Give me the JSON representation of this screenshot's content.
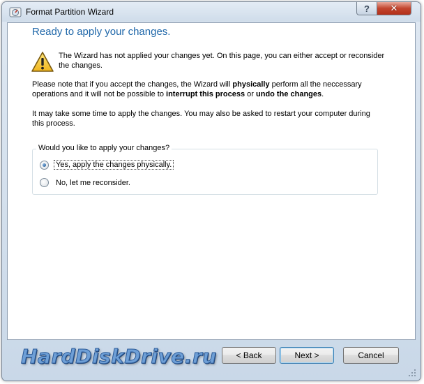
{
  "window": {
    "title": "Format Partition Wizard",
    "help_label": "?",
    "close_label": "✕"
  },
  "page": {
    "heading": "Ready to apply your changes.",
    "warning_text": "The Wizard has not applied your changes yet. On this page, you can either accept or reconsider the changes.",
    "note_prefix": "Please note that if you accept the changes, the Wizard will ",
    "note_bold1": "physically",
    "note_mid": " perform all the neccessary operations and it will not be possible to ",
    "note_bold2": "interrupt this process",
    "note_or": " or ",
    "note_bold3": "undo the changes",
    "note_end": ".",
    "time_text": "It may take some time to apply the changes. You may also be asked to restart your computer during this process."
  },
  "group": {
    "legend": "Would you like to apply your changes?",
    "options": [
      {
        "label": "Yes, apply the changes physically.",
        "selected": true
      },
      {
        "label": "No, let me reconsider.",
        "selected": false
      }
    ]
  },
  "buttons": {
    "back": "< Back",
    "next": "Next >",
    "cancel": "Cancel"
  },
  "watermark": "HardDiskDrive.ru",
  "colors": {
    "heading": "#1f67a9",
    "warning_yellow": "#f4c531",
    "close_red": "#c2452e"
  },
  "icons": [
    "app-icon",
    "help-icon",
    "close-icon",
    "warning-icon",
    "resize-grip-icon"
  ]
}
